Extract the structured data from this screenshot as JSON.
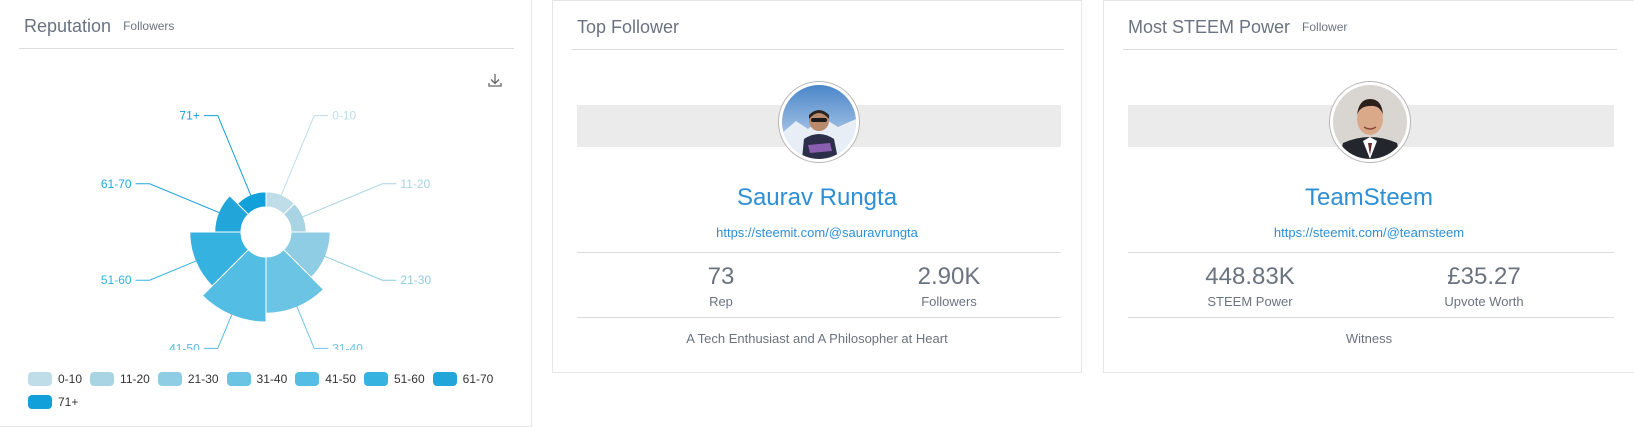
{
  "reputation": {
    "title": "Reputation",
    "subtitle": "Followers",
    "download_icon": "download-icon",
    "chart_data": {
      "type": "pie",
      "variant": "variable-radius",
      "categories": [
        "0-10",
        "11-20",
        "21-30",
        "31-40",
        "41-50",
        "51-60",
        "61-70",
        "71+"
      ],
      "values": [
        1,
        1,
        10,
        22,
        30,
        18,
        4,
        1
      ],
      "colors": [
        "#bfdde9",
        "#a9d4e4",
        "#8ecde3",
        "#6cc4e5",
        "#53bde3",
        "#35b2e0",
        "#22a6d9",
        "#12a0db"
      ],
      "legend_position": "bottom"
    }
  },
  "top_follower": {
    "title": "Top Follower",
    "name": "Saurav Rungta",
    "url": "https://steemit.com/@sauravrungta",
    "stats": [
      {
        "value": "73",
        "label": "Rep"
      },
      {
        "value": "2.90K",
        "label": "Followers"
      }
    ],
    "bio": "A Tech Enthusiast and A Philosopher at Heart"
  },
  "most_sp": {
    "title": "Most STEEM Power",
    "subtitle": "Follower",
    "name": "TeamSteem",
    "url": "https://steemit.com/@teamsteem",
    "stats": [
      {
        "value": "448.83K",
        "label": "STEEM Power"
      },
      {
        "value": "£35.27",
        "label": "Upvote Worth"
      }
    ],
    "bio": "Witness"
  }
}
